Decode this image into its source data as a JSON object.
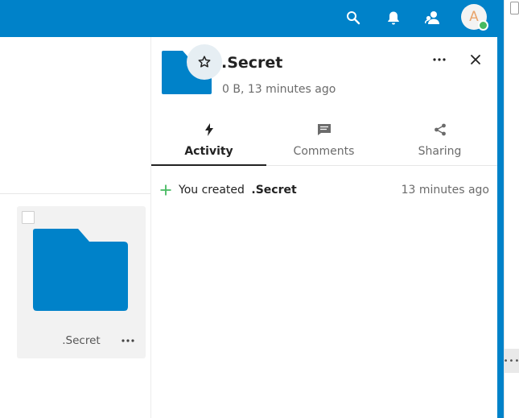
{
  "header": {
    "icons": [
      "search-icon",
      "notifications-icon",
      "contacts-icon"
    ],
    "avatar_initial": "A",
    "accent_color": "#0082c9",
    "status_color": "#46ba61"
  },
  "files": {
    "items": [
      {
        "name": ".Secret",
        "icon": "folder-icon"
      }
    ]
  },
  "sidebar": {
    "title": ".Secret",
    "subtitle": "0 B, 13 minutes ago",
    "tabs": [
      {
        "label": "Activity",
        "icon": "activity-icon",
        "active": true
      },
      {
        "label": "Comments",
        "icon": "comment-icon",
        "active": false
      },
      {
        "label": "Sharing",
        "icon": "share-icon",
        "active": false
      }
    ],
    "activity": [
      {
        "text": "You created",
        "object": ".Secret",
        "time": "13 minutes ago",
        "icon": "plus-icon"
      }
    ]
  }
}
